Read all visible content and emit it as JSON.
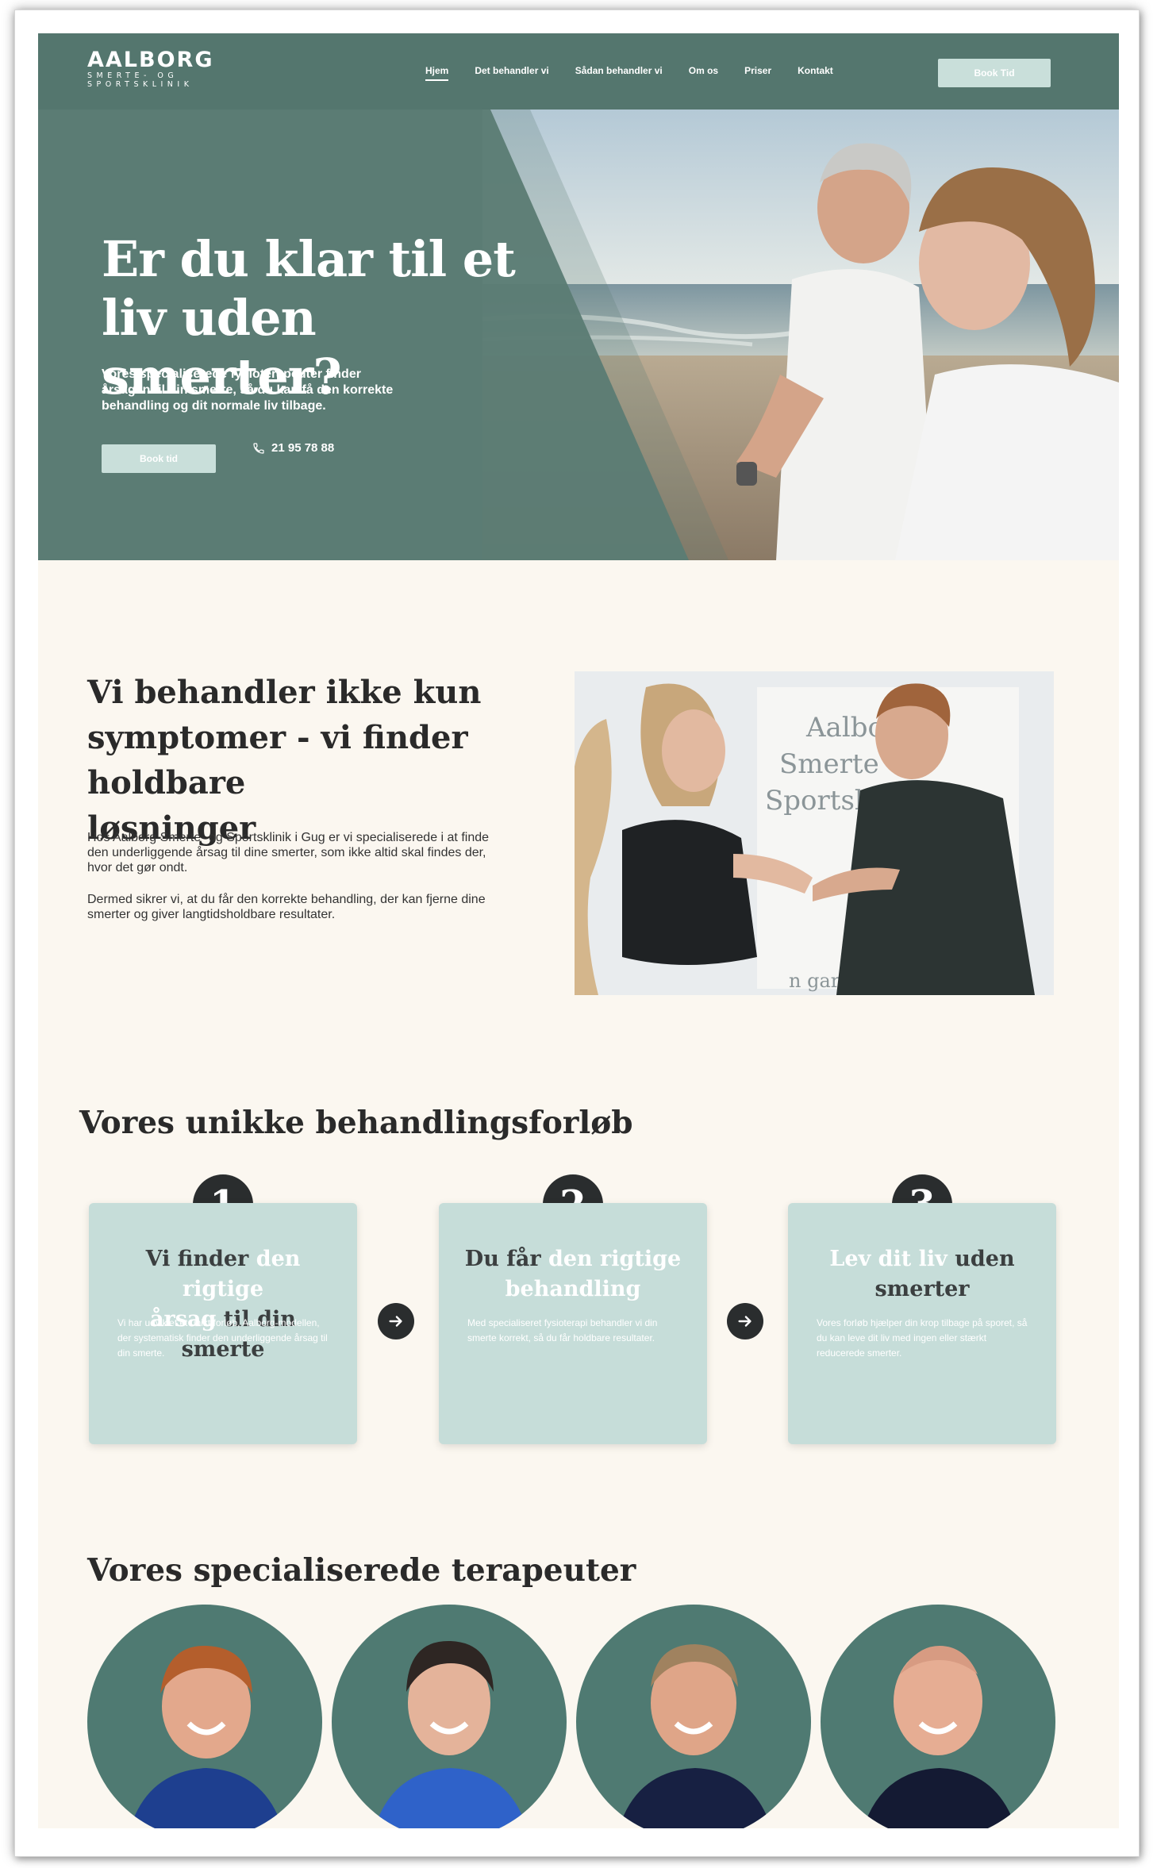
{
  "logo": {
    "main": "AALBORG",
    "sub1": "SMERTE- OG",
    "sub2": "SPORTSKLINIK"
  },
  "nav": {
    "items": [
      "Hjem",
      "Det behandler vi",
      "Sådan behandler vi",
      "Om os",
      "Priser",
      "Kontakt"
    ],
    "active": "Hjem",
    "cta": "Book Tid"
  },
  "hero": {
    "title_line1": "Er du klar til et",
    "title_line2": "liv uden smerter?",
    "text": "Vores specialiserede fysioterapeuter finder årsagen til din smerte, så du kan få den korrekte behandling og dit normale liv tilbage.",
    "book_label": "Book tid",
    "phone": "21 95 78 88"
  },
  "intro": {
    "title_line1": "Vi behandler ikke kun",
    "title_line2": "symptomer - vi finder holdbare",
    "title_line3": "løsninger",
    "p1": "Hos Aalborg Smerte- og Sportsklinik i Gug er vi specialiserede i at finde den underliggende årsag til dine smerter, som ikke altid skal findes der, hvor det gør ondt.",
    "p2": "Dermed sikrer vi, at du får den korrekte behandling, der kan fjerne dine smerter og giver langtidsholdbare resultater.",
    "photo_sign": [
      "Aalbor",
      "Smerte",
      "Sportsklin"
    ],
    "photo_banner": "n garanti f"
  },
  "process": {
    "title": "Vores unikke behandlingsforløb",
    "steps": [
      {
        "num": "1",
        "t1": "Vi finder ",
        "t2": "den rigtige",
        "t3": "årsag",
        "t4": " til din smerte",
        "text": "Vi har udviklet et unikt forløb, Aalborg-modellen, der systematisk finder den underliggende årsag til din smerte."
      },
      {
        "num": "2",
        "t1": "Du får ",
        "t2": "den rigtige",
        "t3": "behandling",
        "t4": "",
        "text": "Med specialiseret fysioterapi behandler vi din smerte korrekt, så du får holdbare resultater."
      },
      {
        "num": "3",
        "t1": "Lev dit liv",
        "t2": " uden",
        "t3": "smerter",
        "t4": "",
        "text": "Vores forløb hjælper din krop tilbage på sporet, så du kan leve dit liv med ingen eller stærkt reducerede smerter."
      }
    ]
  },
  "therapists": {
    "title": "Vores specialiserede terapeuter"
  },
  "colors": {
    "hero_green": "#5b7c74",
    "mint": "#c6ddd9",
    "cream": "#fbf7f0",
    "dark": "#2a2d2e",
    "teal_circle": "#4f7a72"
  },
  "icons": [
    "phone-icon",
    "arrow-right-icon"
  ]
}
